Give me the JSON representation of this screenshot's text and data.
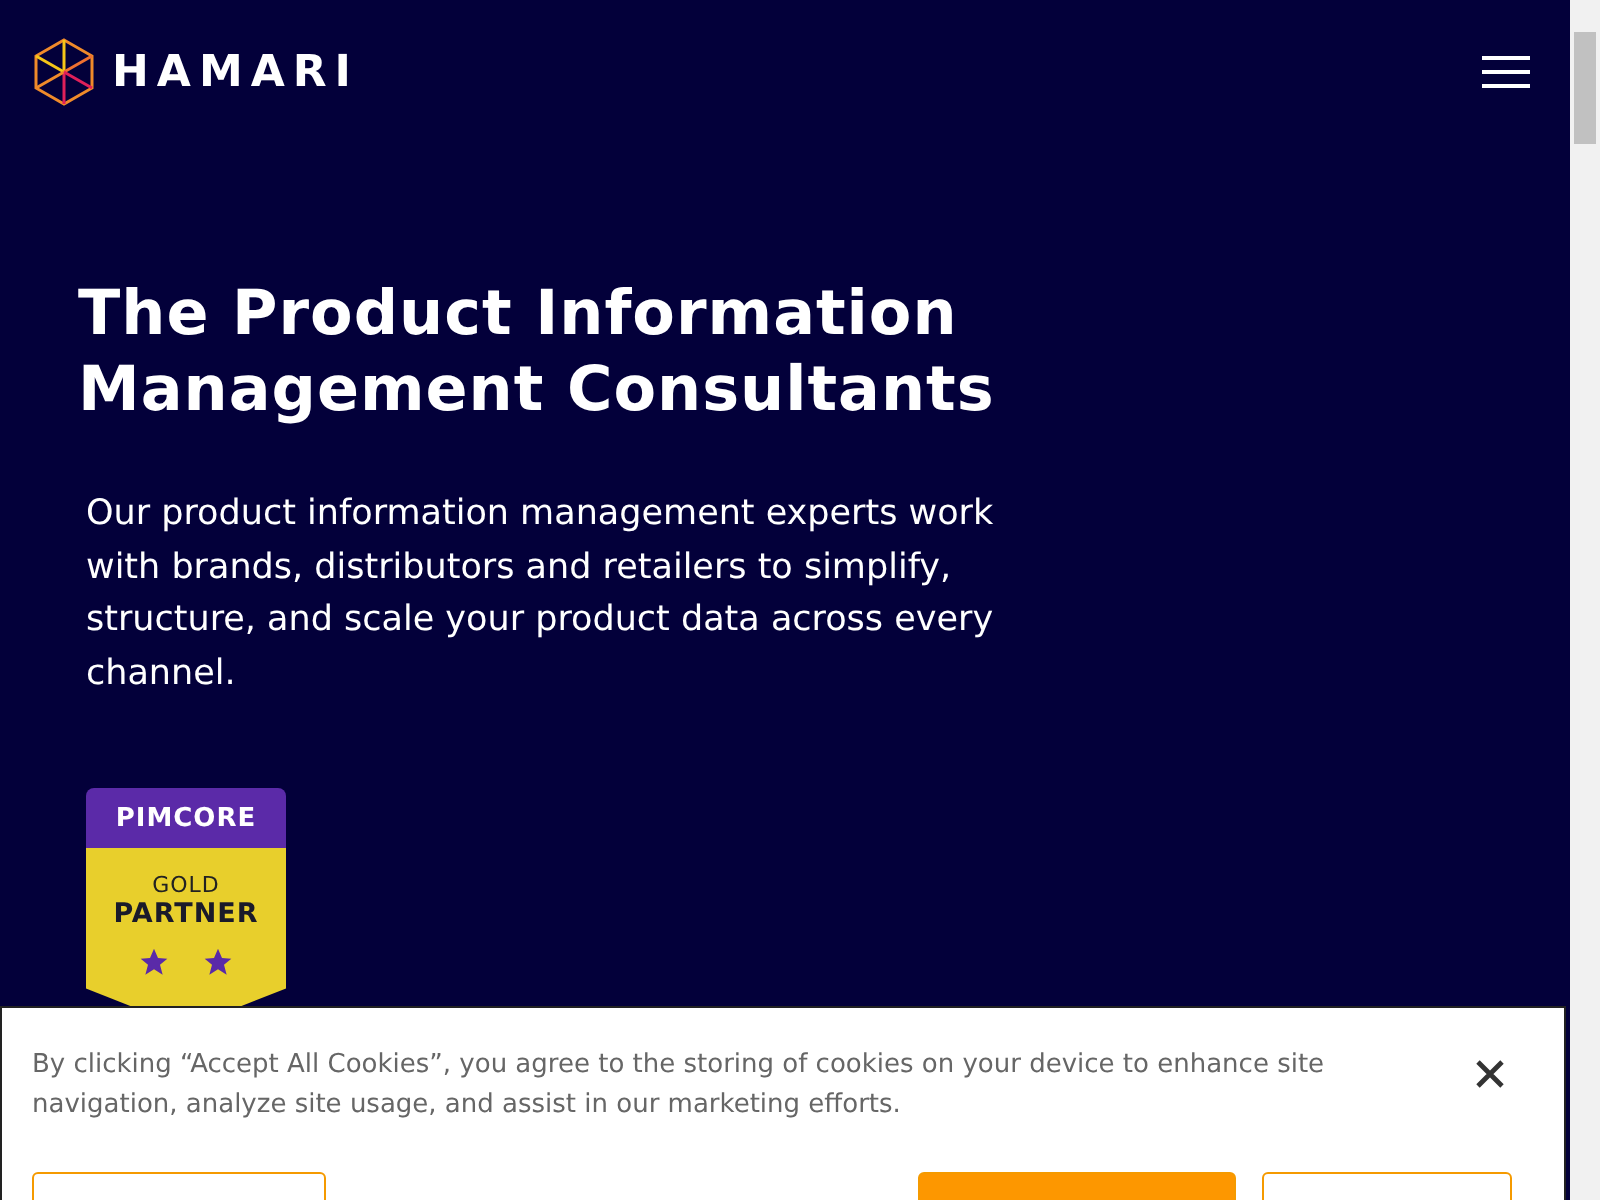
{
  "header": {
    "brand": "HAMARI"
  },
  "hero": {
    "title": "The Product Information Management Consultants",
    "text": "Our product information management experts work with brands, distributors and retailers to simplify, structure, and scale your product data across every channel."
  },
  "badge": {
    "brand": "PIMCORE",
    "tier": "GOLD",
    "label": "PARTNER"
  },
  "cookie_banner": {
    "text": "By clicking “Accept All Cookies”, you agree to the storing of cookies on your device to enhance site navigation, analyze site usage, and assist in our marketing efforts.",
    "buttons": [
      {
        "kind": "outline"
      },
      {
        "kind": "filled"
      },
      {
        "kind": "outline"
      }
    ]
  }
}
